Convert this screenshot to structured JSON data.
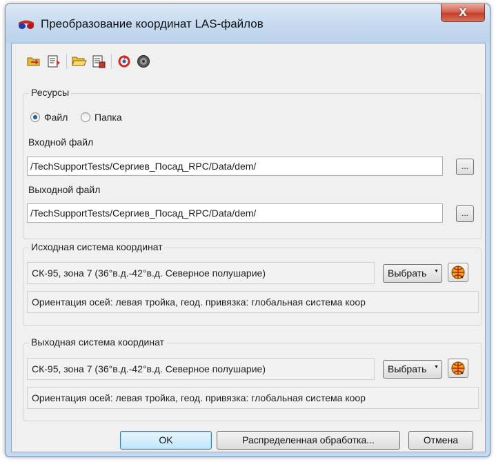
{
  "window": {
    "title": "Преобразование координат LAS-файлов",
    "close_label": "X"
  },
  "toolbar": {
    "buttons": [
      "open-folder-arrow-icon",
      "load-settings-icon",
      "open-folder-icon",
      "save-settings-icon",
      "refresh-icon",
      "settings-gear-icon"
    ]
  },
  "resources": {
    "legend": "Ресурсы",
    "radio_file": "Файл",
    "radio_folder": "Папка",
    "selected": "Файл",
    "input_label": "Входной файл",
    "input_value": "/TechSupportTests/Сергиев_Посад_RPC/Data/dem/",
    "output_label": "Выходной файл",
    "output_value": "/TechSupportTests/Сергиев_Посад_RPC/Data/dem/",
    "browse_label": "..."
  },
  "source_cs": {
    "legend": "Исходная система координат",
    "value": "СК-95, зона 7 (36°в.д.-42°в.д. Северное полушарие)",
    "select_label": "Выбрать",
    "orientation": "Ориентация осей: левая тройка, геод. привязка: глобальная система коор"
  },
  "target_cs": {
    "legend": "Выходная система координат",
    "value": "СК-95, зона 7 (36°в.д.-42°в.д. Северное полушарие)",
    "select_label": "Выбрать",
    "orientation": "Ориентация осей: левая тройка, геод. привязка: глобальная система коор"
  },
  "buttons": {
    "ok": "OK",
    "distributed": "Распределенная обработка...",
    "cancel": "Отмена"
  }
}
